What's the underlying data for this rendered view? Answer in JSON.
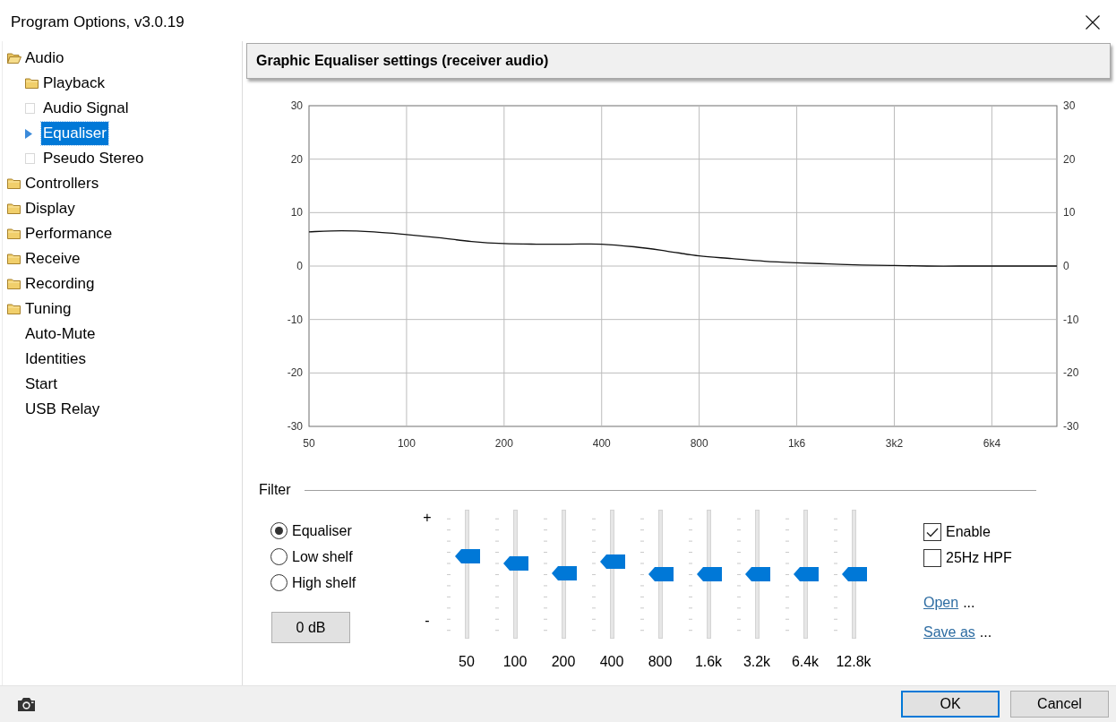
{
  "window": {
    "title": "Program Options, v3.0.19"
  },
  "sidebar": {
    "items": [
      {
        "label": "Audio",
        "kind": "folder",
        "expanded": true,
        "selected": false,
        "children": [
          {
            "label": "Playback",
            "kind": "folder",
            "expanded": false,
            "selected": false
          },
          {
            "label": "Audio Signal",
            "kind": "page",
            "selected": false
          },
          {
            "label": "Equaliser",
            "kind": "page",
            "selected": true
          },
          {
            "label": "Pseudo Stereo",
            "kind": "page",
            "selected": false
          }
        ]
      },
      {
        "label": "Controllers",
        "kind": "folder",
        "expanded": false,
        "selected": false
      },
      {
        "label": "Display",
        "kind": "folder",
        "expanded": false,
        "selected": false
      },
      {
        "label": "Performance",
        "kind": "folder",
        "expanded": false,
        "selected": false
      },
      {
        "label": "Receive",
        "kind": "folder",
        "expanded": false,
        "selected": false
      },
      {
        "label": "Recording",
        "kind": "folder",
        "expanded": false,
        "selected": false
      },
      {
        "label": "Tuning",
        "kind": "folder",
        "expanded": false,
        "selected": false
      },
      {
        "label": "Auto-Mute",
        "kind": "plain",
        "selected": false
      },
      {
        "label": "Identities",
        "kind": "plain",
        "selected": false
      },
      {
        "label": "Start",
        "kind": "plain",
        "selected": false
      },
      {
        "label": "USB Relay",
        "kind": "plain",
        "selected": false
      }
    ]
  },
  "equaliser": {
    "header": "Graphic Equaliser settings (receiver audio)",
    "chart_data": {
      "type": "line",
      "categories": [
        "50",
        null,
        null,
        "100",
        null,
        null,
        "200",
        null,
        null,
        "400",
        null,
        null,
        "800",
        null,
        null,
        "1k6",
        null,
        null,
        "3k2",
        null,
        null,
        "6k4",
        null,
        null
      ],
      "values": [
        6.4,
        6.6,
        6.4,
        5.9,
        5.3,
        4.6,
        4.2,
        4.1,
        4.1,
        4.1,
        3.6,
        2.8,
        1.9,
        1.4,
        0.9,
        0.6,
        0.4,
        0.2,
        0.1,
        0,
        0,
        0,
        0,
        0
      ],
      "ylim": [
        -30,
        30
      ],
      "yticks": [
        -30,
        -20,
        -10,
        0,
        10,
        20,
        30
      ],
      "y2lim": [
        -30,
        30
      ],
      "y2ticks": [
        -30,
        -20,
        -10,
        0,
        10,
        20,
        30
      ],
      "grid": true
    }
  },
  "filter": {
    "title": "Filter",
    "modes": [
      {
        "label": "Equaliser",
        "selected": true
      },
      {
        "label": "Low shelf",
        "selected": false
      },
      {
        "label": "High shelf",
        "selected": false
      }
    ],
    "gain_button": "0 dB",
    "scale": {
      "top": "+",
      "bottom": "-"
    },
    "bands": [
      {
        "label": "50",
        "level": 0.64
      },
      {
        "label": "100",
        "level": 0.58
      },
      {
        "label": "200",
        "level": 0.51
      },
      {
        "label": "400",
        "level": 0.6
      },
      {
        "label": "800",
        "level": 0.5
      },
      {
        "label": "1.6k",
        "level": 0.5
      },
      {
        "label": "3.2k",
        "level": 0.5
      },
      {
        "label": "6.4k",
        "level": 0.5
      },
      {
        "label": "12.8k",
        "level": 0.5
      }
    ],
    "options": [
      {
        "label": "Enable",
        "checked": true
      },
      {
        "label": "25Hz HPF",
        "checked": false
      }
    ],
    "links": [
      {
        "label": "Open",
        "suffix": "..."
      },
      {
        "label": "Save as",
        "suffix": "..."
      }
    ]
  },
  "footer": {
    "buttons": [
      {
        "label": "OK",
        "default": true
      },
      {
        "label": "Cancel",
        "default": false
      }
    ]
  }
}
